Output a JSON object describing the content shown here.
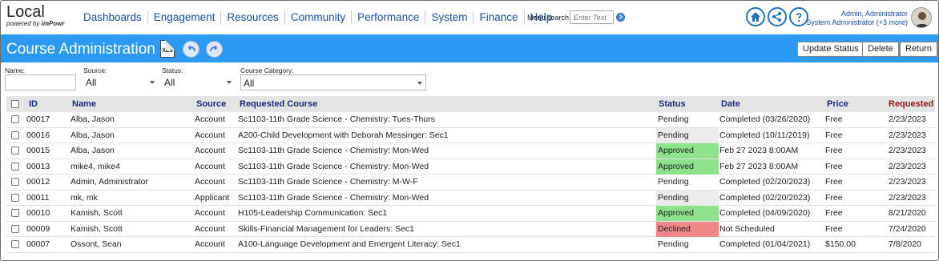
{
  "logo": {
    "main": "Local",
    "sub_prefix": "powered by ",
    "sub_brand": "imPowr"
  },
  "menu": [
    "Dashboards",
    "Engagement",
    "Resources",
    "Community",
    "Performance",
    "System",
    "Finance",
    "Help"
  ],
  "menu_search": {
    "label": "Menu search:",
    "placeholder": "Enter Text"
  },
  "user": {
    "name": "Admin, Administrator",
    "role": "System Administrator (+3 more)"
  },
  "page": {
    "title": "Course Administration",
    "xls_label": "XLS"
  },
  "header_buttons": {
    "update_status": "Update Status",
    "delete": "Delete",
    "return": "Return"
  },
  "filters": {
    "name": {
      "label": "Name:",
      "value": ""
    },
    "source": {
      "label": "Source:",
      "value": "All"
    },
    "status": {
      "label": "Status:",
      "value": "All"
    },
    "category": {
      "label": "Course Category:",
      "value": "All"
    }
  },
  "table": {
    "columns": {
      "id": "ID",
      "name": "Name",
      "source": "Source",
      "course": "Requested Course",
      "status": "Status",
      "date": "Date",
      "price": "Price",
      "requested": "Requested"
    },
    "rows": [
      {
        "id": "00017",
        "name": "Alba, Jason",
        "source": "Account",
        "course": "Sc1103-11th Grade Science - Chemistry: Tues-Thurs",
        "status": "Pending",
        "date": "Completed (03/26/2020)",
        "price": "Free",
        "requested": "2/23/2023"
      },
      {
        "id": "00016",
        "name": "Alba, Jason",
        "source": "Account",
        "course": "A200-Child Development with Deborah Messinger: Sec1",
        "status": "Pending",
        "date": "Completed (10/11/2019)",
        "price": "Free",
        "requested": "2/23/2023"
      },
      {
        "id": "00015",
        "name": "Alba, Jason",
        "source": "Account",
        "course": "Sc1103-11th Grade Science - Chemistry: Mon-Wed",
        "status": "Approved",
        "date": "Feb 27 2023 8:00AM",
        "price": "Free",
        "requested": "2/23/2023"
      },
      {
        "id": "00013",
        "name": "mike4, mike4",
        "source": "Account",
        "course": "Sc1103-11th Grade Science - Chemistry: Mon-Wed",
        "status": "Approved",
        "date": "Feb 27 2023 8:00AM",
        "price": "Free",
        "requested": "2/23/2023"
      },
      {
        "id": "00012",
        "name": "Admin, Administrator",
        "source": "Account",
        "course": "Sc1103-11th Grade Science - Chemistry: M-W-F",
        "status": "Pending",
        "date": "Completed (02/20/2023)",
        "price": "Free",
        "requested": "2/23/2023"
      },
      {
        "id": "00011",
        "name": "mk, mk",
        "source": "Applicant",
        "course": "Sc1103-11th Grade Science - Chemistry: Mon-Wed",
        "status": "Pending",
        "date": "Completed (02/20/2023)",
        "price": "Free",
        "requested": "2/23/2023"
      },
      {
        "id": "00010",
        "name": "Kamish, Scott",
        "source": "Account",
        "course": "H105-Leadership Communication: Sec1",
        "status": "Approved",
        "date": "Completed (04/09/2020)",
        "price": "Free",
        "requested": "8/21/2020"
      },
      {
        "id": "00009",
        "name": "Kamish, Scott",
        "source": "Account",
        "course": "Skills-Financial Management for Leaders: Sec1",
        "status": "Declined",
        "date": "Not Scheduled",
        "price": "Free",
        "requested": "7/24/2020"
      },
      {
        "id": "00007",
        "name": "Ossont, Sean",
        "source": "Account",
        "course": "A100-Language Development and Emergent Literacy: Sec1",
        "status": "Pending",
        "date": "Completed (01/04/2021)",
        "price": "$150.00",
        "requested": "7/8/2020"
      }
    ]
  },
  "colors": {
    "header_blue": "#2c9af2",
    "approved": "#8de38a",
    "declined": "#ef8787",
    "pending_alt": "#ebebeb",
    "requested_header": "#8b1a1a"
  }
}
